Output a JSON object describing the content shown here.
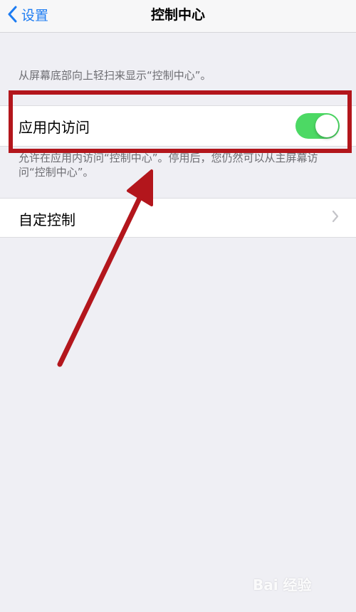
{
  "nav": {
    "back_label": "设置",
    "title": "控制中心"
  },
  "description": "从屏幕底部向上轻扫来显示“控制中心”。",
  "access_cell": {
    "label": "应用内访问",
    "toggle_on": true
  },
  "footnote": "允许在应用内访问“控制中心”。停用后，您仍然可以从主屏幕访问“控制中心”。",
  "custom_cell": {
    "label": "自定控制"
  },
  "watermark": "Bai 经验",
  "colors": {
    "accent": "#1d7cf2",
    "toggle_on": "#4cd964",
    "annotation": "#b3161c",
    "background": "#efeff4"
  },
  "icons": {
    "back": "chevron-left-icon",
    "disclosure": "chevron-right-icon"
  }
}
